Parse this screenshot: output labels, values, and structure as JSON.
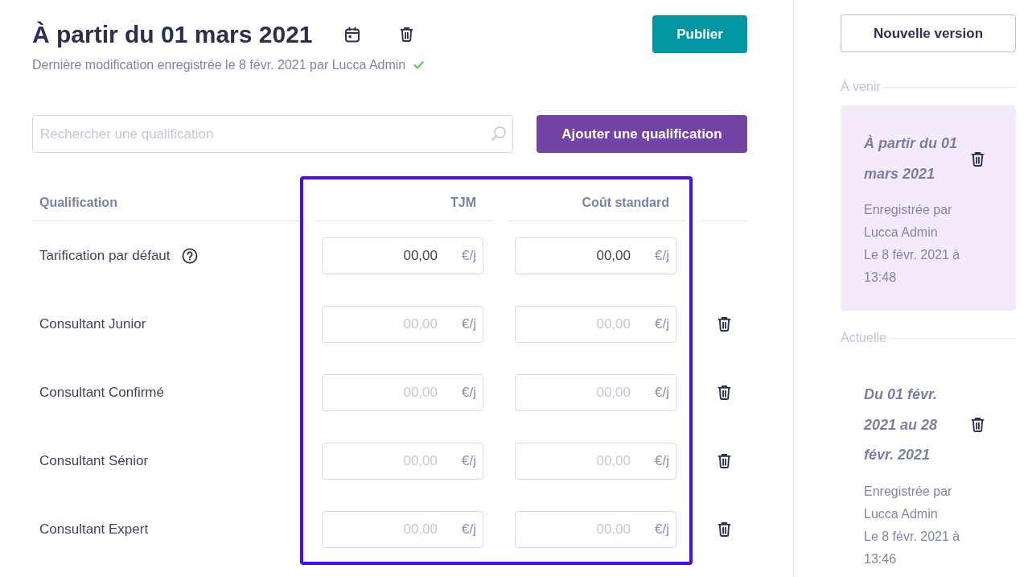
{
  "header": {
    "title": "À partir du 01 mars 2021",
    "subtitle": "Dernière modification enregistrée le 8 févr. 2021 par Lucca Admin",
    "saved": true,
    "publish_button": "Publier"
  },
  "search": {
    "placeholder": "Rechercher une qualification"
  },
  "add_button": "Ajouter une qualification",
  "table": {
    "columns": [
      "Qualification",
      "TJM",
      "Coût standard"
    ],
    "rows": [
      {
        "name": "Tarification par défaut",
        "help": true,
        "deletable": false,
        "tjm": {
          "value": "00,00",
          "unit": "€/j"
        },
        "cost": {
          "value": "00,00",
          "unit": "€/j"
        }
      },
      {
        "name": "Consultant Junior",
        "help": false,
        "deletable": true,
        "tjm": {
          "placeholder": "00,00",
          "unit": "€/j"
        },
        "cost": {
          "placeholder": "00,00",
          "unit": "€/j"
        }
      },
      {
        "name": "Consultant Confirmé",
        "help": false,
        "deletable": true,
        "tjm": {
          "placeholder": "00,00",
          "unit": "€/j"
        },
        "cost": {
          "placeholder": "00,00",
          "unit": "€/j"
        }
      },
      {
        "name": "Consultant Sénior",
        "help": false,
        "deletable": true,
        "tjm": {
          "placeholder": "00,00",
          "unit": "€/j"
        },
        "cost": {
          "placeholder": "00,00",
          "unit": "€/j"
        }
      },
      {
        "name": "Consultant Expert",
        "help": false,
        "deletable": true,
        "tjm": {
          "placeholder": "00,00",
          "unit": "€/j"
        },
        "cost": {
          "placeholder": "00,00",
          "unit": "€/j"
        }
      }
    ]
  },
  "sidebar": {
    "new_version_button": "Nouvelle version",
    "sections": [
      {
        "label": "À venir",
        "versions": [
          {
            "title": "À partir du 01 mars 2021",
            "author": "Enregistrée par Lucca Admin",
            "saved_at": "Le 8 févr. 2021 à 13:48",
            "selected": true
          }
        ]
      },
      {
        "label": "Actuelle",
        "versions": [
          {
            "title": "Du 01 févr. 2021 au 28 févr. 2021",
            "author": "Enregistrée par Lucca Admin",
            "saved_at": "Le 8 févr. 2021 à 13:46",
            "selected": false
          }
        ]
      }
    ]
  }
}
